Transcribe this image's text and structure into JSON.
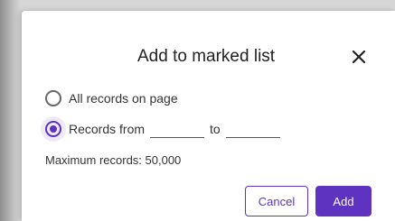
{
  "dialog": {
    "title": "Add to marked list",
    "close_icon": "close-icon",
    "options": [
      {
        "label": "All records on page",
        "selected": false
      },
      {
        "label": "Records from",
        "selected": true,
        "to_label": "to",
        "from_value": "",
        "to_value": ""
      }
    ],
    "max_records_text": "Maximum records: 50,000",
    "cancel_label": "Cancel",
    "add_label": "Add"
  },
  "colors": {
    "accent": "#5e33bf",
    "text": "#333333",
    "backdrop": "#d6d6d6"
  }
}
